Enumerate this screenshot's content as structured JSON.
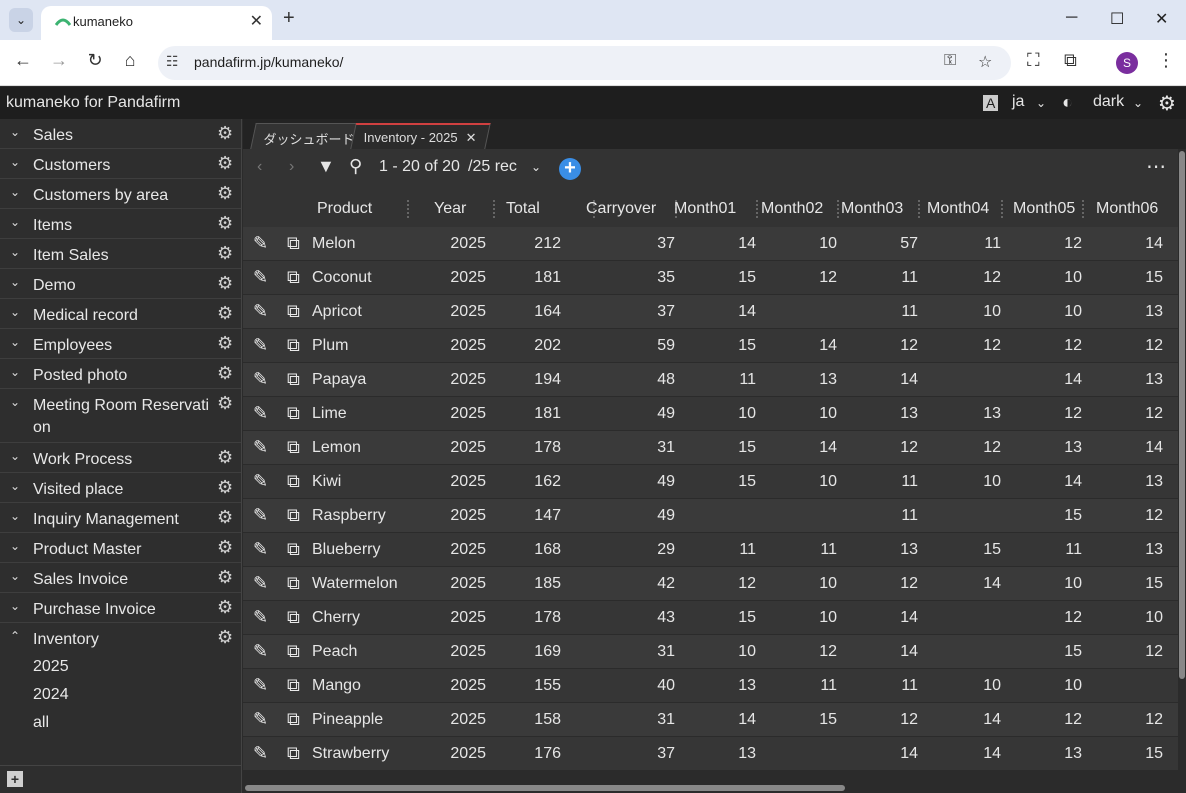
{
  "browser": {
    "tab_title": "kumaneko",
    "url": "pandafirm.jp/kumaneko/",
    "profile_initial": "S"
  },
  "app": {
    "brand": "kumaneko for Pandafirm",
    "language": "ja",
    "theme": "dark"
  },
  "sidebar": {
    "items": [
      {
        "label": "Sales"
      },
      {
        "label": "Customers"
      },
      {
        "label": "Customers by area"
      },
      {
        "label": "Items"
      },
      {
        "label": "Item Sales"
      },
      {
        "label": "Demo"
      },
      {
        "label": "Medical record"
      },
      {
        "label": "Employees"
      },
      {
        "label": "Posted photo"
      },
      {
        "label": "Meeting Room Reservati on"
      },
      {
        "label": "Work Process"
      },
      {
        "label": "Visited place"
      },
      {
        "label": "Inquiry Management"
      },
      {
        "label": "Product Master"
      },
      {
        "label": "Sales Invoice"
      },
      {
        "label": "Purchase Invoice"
      },
      {
        "label": "Inventory"
      }
    ],
    "inventory_views": [
      "2025",
      "2024",
      "all"
    ]
  },
  "tabs": [
    {
      "label": "ダッシュボード"
    },
    {
      "label": "Inventory - 2025"
    }
  ],
  "pager": {
    "range": "1 - 20 of 20",
    "per_page": "/25 rec"
  },
  "columns": [
    "Product",
    "Year",
    "Total",
    "Carryover",
    "Month01",
    "Month02",
    "Month03",
    "Month04",
    "Month05",
    "Month06"
  ],
  "rows": [
    [
      "Melon",
      "2025",
      "212",
      "37",
      "14",
      "10",
      "57",
      "11",
      "12",
      "14"
    ],
    [
      "Coconut",
      "2025",
      "181",
      "35",
      "15",
      "12",
      "11",
      "12",
      "10",
      "15"
    ],
    [
      "Apricot",
      "2025",
      "164",
      "37",
      "14",
      "",
      "11",
      "10",
      "10",
      "13"
    ],
    [
      "Plum",
      "2025",
      "202",
      "59",
      "15",
      "14",
      "12",
      "12",
      "12",
      "12"
    ],
    [
      "Papaya",
      "2025",
      "194",
      "48",
      "11",
      "13",
      "14",
      "",
      "14",
      "13"
    ],
    [
      "Lime",
      "2025",
      "181",
      "49",
      "10",
      "10",
      "13",
      "13",
      "12",
      "12"
    ],
    [
      "Lemon",
      "2025",
      "178",
      "31",
      "15",
      "14",
      "12",
      "12",
      "13",
      "14"
    ],
    [
      "Kiwi",
      "2025",
      "162",
      "49",
      "15",
      "10",
      "11",
      "10",
      "14",
      "13"
    ],
    [
      "Raspberry",
      "2025",
      "147",
      "49",
      "",
      "",
      "11",
      "",
      "15",
      "12"
    ],
    [
      "Blueberry",
      "2025",
      "168",
      "29",
      "11",
      "11",
      "13",
      "15",
      "11",
      "13"
    ],
    [
      "Watermelon",
      "2025",
      "185",
      "42",
      "12",
      "10",
      "12",
      "14",
      "10",
      "15"
    ],
    [
      "Cherry",
      "2025",
      "178",
      "43",
      "15",
      "10",
      "14",
      "",
      "12",
      "10"
    ],
    [
      "Peach",
      "2025",
      "169",
      "31",
      "10",
      "12",
      "14",
      "",
      "15",
      "12"
    ],
    [
      "Mango",
      "2025",
      "155",
      "40",
      "13",
      "11",
      "11",
      "10",
      "10",
      ""
    ],
    [
      "Pineapple",
      "2025",
      "158",
      "31",
      "14",
      "15",
      "12",
      "14",
      "12",
      "12"
    ],
    [
      "Strawberry",
      "2025",
      "176",
      "37",
      "13",
      "",
      "14",
      "14",
      "13",
      "15"
    ]
  ]
}
